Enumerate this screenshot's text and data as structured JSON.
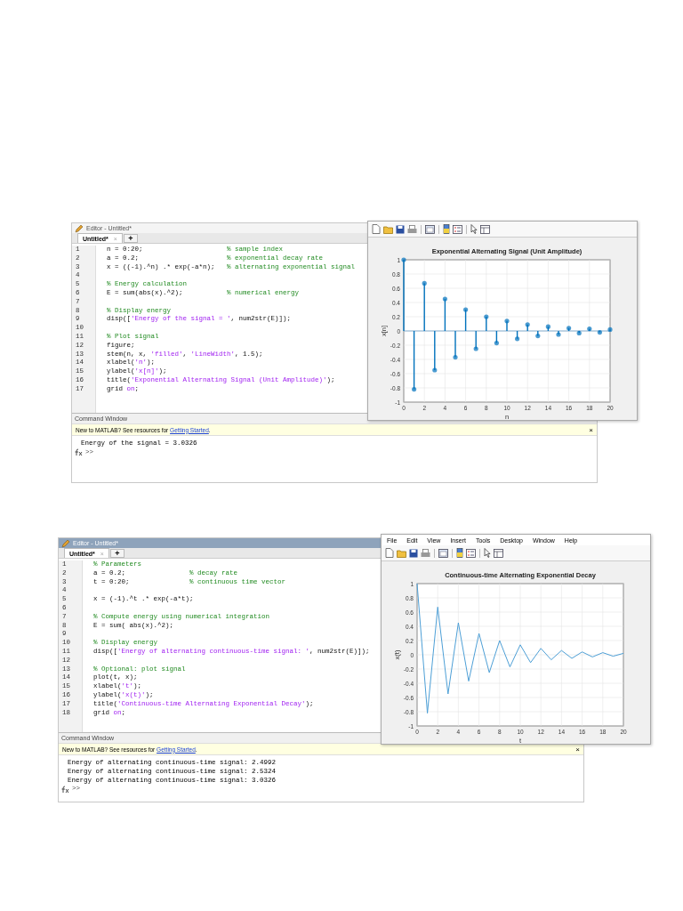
{
  "panels": [
    {
      "editor": {
        "title": "Editor - Untitled*",
        "title_active": false,
        "tab": "Untitled*",
        "tab_close": "×",
        "new_tab": "+",
        "lines": [
          {
            "number": "1",
            "segments": [
              {
                "kind": "code",
                "text": "n = 0:20;"
              }
            ],
            "aside": "% sample index"
          },
          {
            "number": "2",
            "segments": [
              {
                "kind": "code",
                "text": "a = 0.2;"
              }
            ],
            "aside": "% exponential decay rate"
          },
          {
            "number": "3",
            "segments": [
              {
                "kind": "code",
                "text": "x = ((-1).^n) .* exp(-a*n);"
              }
            ],
            "aside": "% alternating exponential signal"
          },
          {
            "number": "4"
          },
          {
            "number": "5",
            "segments": [
              {
                "kind": "comment",
                "text": "% Energy calculation"
              }
            ]
          },
          {
            "number": "6",
            "segments": [
              {
                "kind": "code",
                "text": "E = sum(abs(x).^2);"
              }
            ],
            "aside": "% numerical energy"
          },
          {
            "number": "7"
          },
          {
            "number": "8",
            "segments": [
              {
                "kind": "comment",
                "text": "% Display energy"
              }
            ]
          },
          {
            "number": "9",
            "segments": [
              {
                "kind": "code",
                "text": "disp(["
              },
              {
                "kind": "string",
                "text": "'Energy of the signal = '"
              },
              {
                "kind": "code",
                "text": ", num2str(E)]);"
              }
            ]
          },
          {
            "number": "10"
          },
          {
            "number": "11",
            "segments": [
              {
                "kind": "comment",
                "text": "% Plot signal"
              }
            ]
          },
          {
            "number": "12",
            "segments": [
              {
                "kind": "code",
                "text": "figure;"
              }
            ]
          },
          {
            "number": "13",
            "segments": [
              {
                "kind": "code",
                "text": "stem(n, x, "
              },
              {
                "kind": "string",
                "text": "'filled'"
              },
              {
                "kind": "code",
                "text": ", "
              },
              {
                "kind": "string",
                "text": "'LineWidth'"
              },
              {
                "kind": "code",
                "text": ", 1.5);"
              }
            ]
          },
          {
            "number": "14",
            "segments": [
              {
                "kind": "code",
                "text": "xlabel("
              },
              {
                "kind": "string",
                "text": "'n'"
              },
              {
                "kind": "code",
                "text": ");"
              }
            ]
          },
          {
            "number": "15",
            "segments": [
              {
                "kind": "code",
                "text": "ylabel("
              },
              {
                "kind": "string",
                "text": "'x[n]'"
              },
              {
                "kind": "code",
                "text": ");"
              }
            ]
          },
          {
            "number": "16",
            "segments": [
              {
                "kind": "code",
                "text": "title("
              },
              {
                "kind": "string",
                "text": "'Exponential Alternating Signal (Unit Amplitude)'"
              },
              {
                "kind": "code",
                "text": ");"
              }
            ]
          },
          {
            "number": "17",
            "segments": [
              {
                "kind": "code",
                "text": "grid "
              },
              {
                "kind": "string",
                "text": "on"
              },
              {
                "kind": "code",
                "text": ";"
              }
            ]
          }
        ]
      },
      "command_window": {
        "title": "Command Window",
        "notice": "New to MATLAB? See resources for ",
        "link": "Getting Started",
        "notice_end": ".",
        "close": "×",
        "output": [
          "Energy of the signal = 3.0326"
        ],
        "prompt": ">>"
      },
      "figure": {
        "chart_data": {
          "type": "bar",
          "title": "Exponential Alternating Signal (Unit Amplitude)",
          "xlabel": "n",
          "ylabel": "x[n]",
          "x": [
            0,
            1,
            2,
            3,
            4,
            5,
            6,
            7,
            8,
            9,
            10,
            11,
            12,
            13,
            14,
            15,
            16,
            17,
            18,
            19,
            20
          ],
          "series": [
            {
              "color": "#0072bd",
              "values": [
                1,
                -0.82,
                0.67,
                -0.55,
                0.45,
                -0.37,
                0.3,
                -0.25,
                0.2,
                -0.17,
                0.14,
                -0.11,
                0.09,
                -0.07,
                0.06,
                -0.05,
                0.04,
                -0.03,
                0.03,
                -0.02,
                0.02
              ]
            }
          ],
          "xlim": [
            0,
            20
          ],
          "ylim": [
            -1,
            1
          ],
          "xticks": [
            0,
            2,
            4,
            6,
            8,
            10,
            12,
            14,
            16,
            18,
            20
          ],
          "yticks": [
            -1,
            -0.8,
            -0.6,
            -0.4,
            -0.2,
            0,
            0.2,
            0.4,
            0.6,
            0.8,
            1
          ],
          "grid": true,
          "ref_lines": [
            {
              "axis": "y",
              "value": 0,
              "color": "#3c7fb8"
            }
          ]
        }
      }
    },
    {
      "editor": {
        "title": "Editor - Untitled*",
        "title_active": true,
        "tab": "Untitled*",
        "tab_close": "×",
        "new_tab": "+",
        "lines": [
          {
            "number": "1",
            "segments": [
              {
                "kind": "comment",
                "text": "% Parameters"
              }
            ]
          },
          {
            "number": "2",
            "segments": [
              {
                "kind": "code",
                "text": "a = 0.2;"
              }
            ],
            "aside": "% decay rate"
          },
          {
            "number": "3",
            "segments": [
              {
                "kind": "code",
                "text": "t = 0:20;"
              }
            ],
            "aside": "% continuous time vector"
          },
          {
            "number": "4"
          },
          {
            "number": "5",
            "segments": [
              {
                "kind": "code",
                "text": "x = (-1).^t .* exp(-a*t);"
              }
            ]
          },
          {
            "number": "6"
          },
          {
            "number": "7",
            "segments": [
              {
                "kind": "comment",
                "text": "% Compute energy using numerical integration"
              }
            ]
          },
          {
            "number": "8",
            "segments": [
              {
                "kind": "code",
                "text": "E = sum( abs(x).^2);"
              }
            ]
          },
          {
            "number": "9"
          },
          {
            "number": "10",
            "segments": [
              {
                "kind": "comment",
                "text": "% Display energy"
              }
            ]
          },
          {
            "number": "11",
            "segments": [
              {
                "kind": "code",
                "text": "disp(["
              },
              {
                "kind": "string",
                "text": "'Energy of alternating continuous-time signal: '"
              },
              {
                "kind": "code",
                "text": ", num2str(E)]);"
              }
            ]
          },
          {
            "number": "12"
          },
          {
            "number": "13",
            "segments": [
              {
                "kind": "comment",
                "text": "% Optional: plot signal"
              }
            ]
          },
          {
            "number": "14",
            "segments": [
              {
                "kind": "code",
                "text": "plot(t, x);"
              }
            ]
          },
          {
            "number": "15",
            "segments": [
              {
                "kind": "code",
                "text": "xlabel("
              },
              {
                "kind": "string",
                "text": "'t'"
              },
              {
                "kind": "code",
                "text": ");"
              }
            ]
          },
          {
            "number": "16",
            "segments": [
              {
                "kind": "code",
                "text": "ylabel("
              },
              {
                "kind": "string",
                "text": "'x(t)'"
              },
              {
                "kind": "code",
                "text": ");"
              }
            ]
          },
          {
            "number": "17",
            "segments": [
              {
                "kind": "code",
                "text": "title("
              },
              {
                "kind": "string",
                "text": "'Continuous-time Alternating Exponential Decay'"
              },
              {
                "kind": "code",
                "text": ");"
              }
            ]
          },
          {
            "number": "18",
            "segments": [
              {
                "kind": "code",
                "text": "grid "
              },
              {
                "kind": "string",
                "text": "on"
              },
              {
                "kind": "code",
                "text": ";"
              }
            ]
          }
        ]
      },
      "command_window": {
        "title": "Command Window",
        "notice": "New to MATLAB? See resources for ",
        "link": "Getting Started",
        "notice_end": ".",
        "close": "×",
        "output": [
          "Energy of alternating continuous-time signal: 2.4992",
          "Energy of alternating continuous-time signal: 2.5324",
          "Energy of alternating continuous-time signal: 3.0326"
        ],
        "prompt": ">>"
      },
      "figure": {
        "menu": [
          "File",
          "Edit",
          "View",
          "Insert",
          "Tools",
          "Desktop",
          "Window",
          "Help"
        ],
        "chart_data": {
          "type": "line",
          "title": "Continuous-time Alternating Exponential Decay",
          "xlabel": "t",
          "ylabel": "x(t)",
          "x": [
            0,
            1,
            2,
            3,
            4,
            5,
            6,
            7,
            8,
            9,
            10,
            11,
            12,
            13,
            14,
            15,
            16,
            17,
            18,
            19,
            20
          ],
          "series": [
            {
              "color": "#4d9fd6",
              "values": [
                1,
                -0.82,
                0.67,
                -0.55,
                0.45,
                -0.37,
                0.3,
                -0.25,
                0.2,
                -0.17,
                0.14,
                -0.11,
                0.09,
                -0.07,
                0.06,
                -0.05,
                0.04,
                -0.03,
                0.03,
                -0.02,
                0.02
              ]
            }
          ],
          "xlim": [
            0,
            20
          ],
          "ylim": [
            -1,
            1
          ],
          "xticks": [
            0,
            2,
            4,
            6,
            8,
            10,
            12,
            14,
            16,
            18,
            20
          ],
          "yticks": [
            -1,
            -0.8,
            -0.6,
            -0.4,
            -0.2,
            0,
            0.2,
            0.4,
            0.6,
            0.8,
            1
          ],
          "grid": true
        }
      }
    }
  ]
}
